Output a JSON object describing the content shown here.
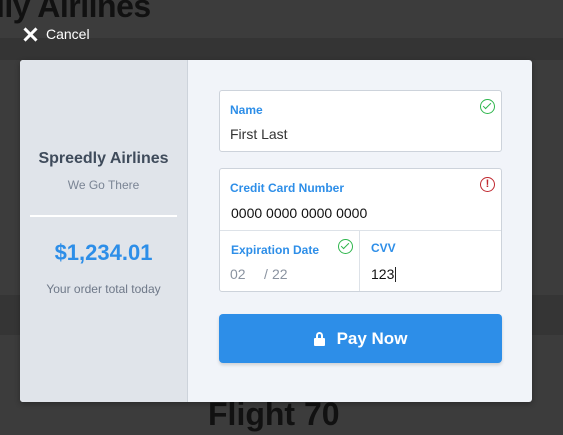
{
  "background": {
    "title": "lly Airlines",
    "flight": "Flight 70"
  },
  "cancel_label": "Cancel",
  "sidebar": {
    "company": "Spreedly Airlines",
    "tagline": "We Go There",
    "amount": "$1,234.01",
    "amount_note": "Your order total today"
  },
  "form": {
    "name": {
      "label": "Name",
      "value": "First Last",
      "status_icon": "check-circle-icon"
    },
    "card": {
      "label": "Credit Card Number",
      "value": "0000 0000 0000 0000",
      "status_icon": "error-circle-icon"
    },
    "expiration": {
      "label": "Expiration Date",
      "month": "02",
      "separator": "/",
      "year": "22",
      "status_icon": "check-circle-icon"
    },
    "cvv": {
      "label": "CVV",
      "value": "123"
    }
  },
  "pay_button": {
    "label": "Pay Now",
    "icon": "lock-icon"
  },
  "colors": {
    "accent": "#2d8ee8",
    "valid": "#2fb64d",
    "error": "#c0282f"
  }
}
